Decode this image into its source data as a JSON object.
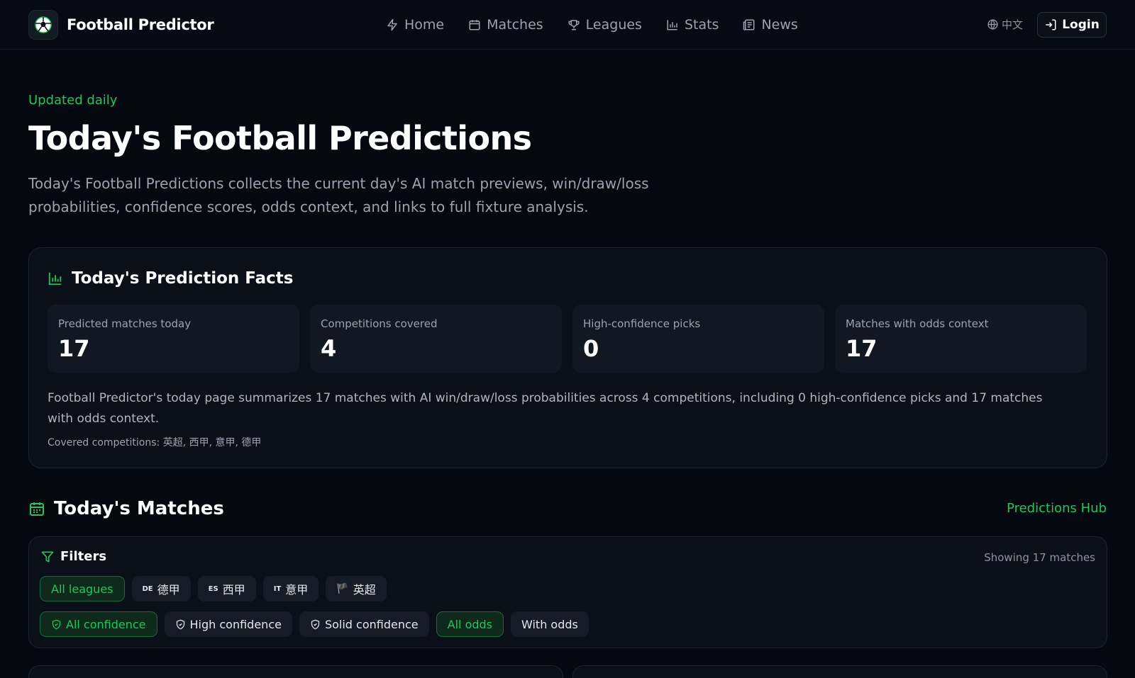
{
  "header": {
    "brand": "Football Predictor",
    "nav": [
      {
        "label": "Home",
        "icon": "lightning-icon"
      },
      {
        "label": "Matches",
        "icon": "calendar-icon"
      },
      {
        "label": "Leagues",
        "icon": "trophy-icon"
      },
      {
        "label": "Stats",
        "icon": "bar-chart-icon"
      },
      {
        "label": "News",
        "icon": "newspaper-icon"
      }
    ],
    "language": "中文",
    "login": "Login"
  },
  "hero": {
    "eyebrow": "Updated daily",
    "title": "Today's Football Predictions",
    "description": "Today's Football Predictions collects the current day's AI match previews, win/draw/loss probabilities, confidence scores, odds context, and links to full fixture analysis."
  },
  "facts": {
    "title": "Today's Prediction Facts",
    "stats": [
      {
        "label": "Predicted matches today",
        "value": "17"
      },
      {
        "label": "Competitions covered",
        "value": "4"
      },
      {
        "label": "High-confidence picks",
        "value": "0"
      },
      {
        "label": "Matches with odds context",
        "value": "17"
      }
    ],
    "summary": "Football Predictor's today page summarizes 17 matches with AI win/draw/loss probabilities across 4 competitions, including 0 high-confidence picks and 17 matches with odds context.",
    "covered": "Covered competitions: 英超, 西甲, 意甲, 德甲"
  },
  "matches": {
    "title": "Today's Matches",
    "hub_link": "Predictions Hub",
    "filters": {
      "title": "Filters",
      "showing": "Showing 17 matches",
      "leagues": [
        {
          "label": "All leagues",
          "flag": "",
          "active": true
        },
        {
          "label": "德甲",
          "flag": "DE",
          "active": false
        },
        {
          "label": "西甲",
          "flag": "ES",
          "active": false
        },
        {
          "label": "意甲",
          "flag": "IT",
          "active": false
        },
        {
          "label": "英超",
          "flag": "🏴",
          "active": false
        }
      ],
      "confidence": [
        {
          "label": "All confidence",
          "active": true
        },
        {
          "label": "High confidence",
          "active": false
        },
        {
          "label": "Solid confidence",
          "active": false
        }
      ],
      "odds": [
        {
          "label": "All odds",
          "active": true
        },
        {
          "label": "With odds",
          "active": false
        }
      ]
    }
  },
  "colors": {
    "accent": "#22c55e",
    "background": "#05080f",
    "card": "#0b1018"
  }
}
